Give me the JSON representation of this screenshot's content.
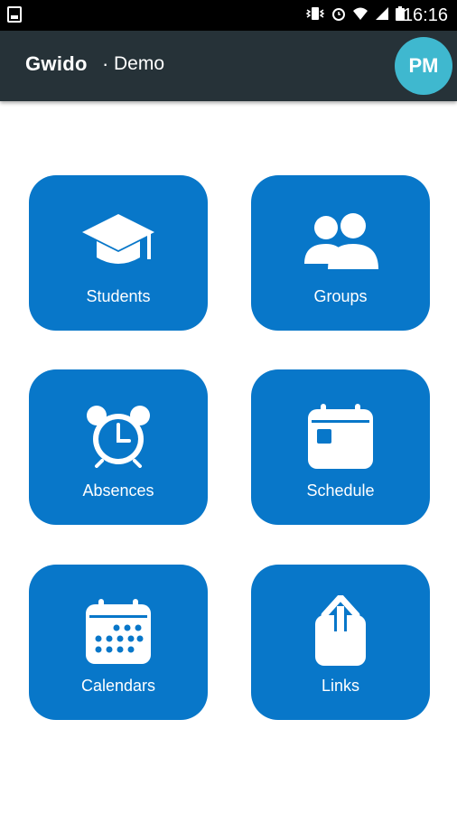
{
  "status_bar": {
    "time": "16:16",
    "icons": [
      "image-icon",
      "vibrate-icon",
      "alarm-icon",
      "wifi-icon",
      "signal-icon",
      "battery-icon"
    ]
  },
  "app_bar": {
    "brand": "Gwido",
    "separator": "·",
    "context": "Demo",
    "avatar_initials": "PM"
  },
  "tiles": [
    {
      "label": "Students",
      "icon": "graduation-cap-icon"
    },
    {
      "label": "Groups",
      "icon": "people-icon"
    },
    {
      "label": "Absences",
      "icon": "alarm-clock-icon"
    },
    {
      "label": "Schedule",
      "icon": "calendar-icon"
    },
    {
      "label": "Calendars",
      "icon": "calendar-grid-icon"
    },
    {
      "label": "Links",
      "icon": "share-icon"
    }
  ],
  "colors": {
    "tile": "#0877c9",
    "app_bar": "#263238",
    "avatar": "#3fb8cf"
  }
}
